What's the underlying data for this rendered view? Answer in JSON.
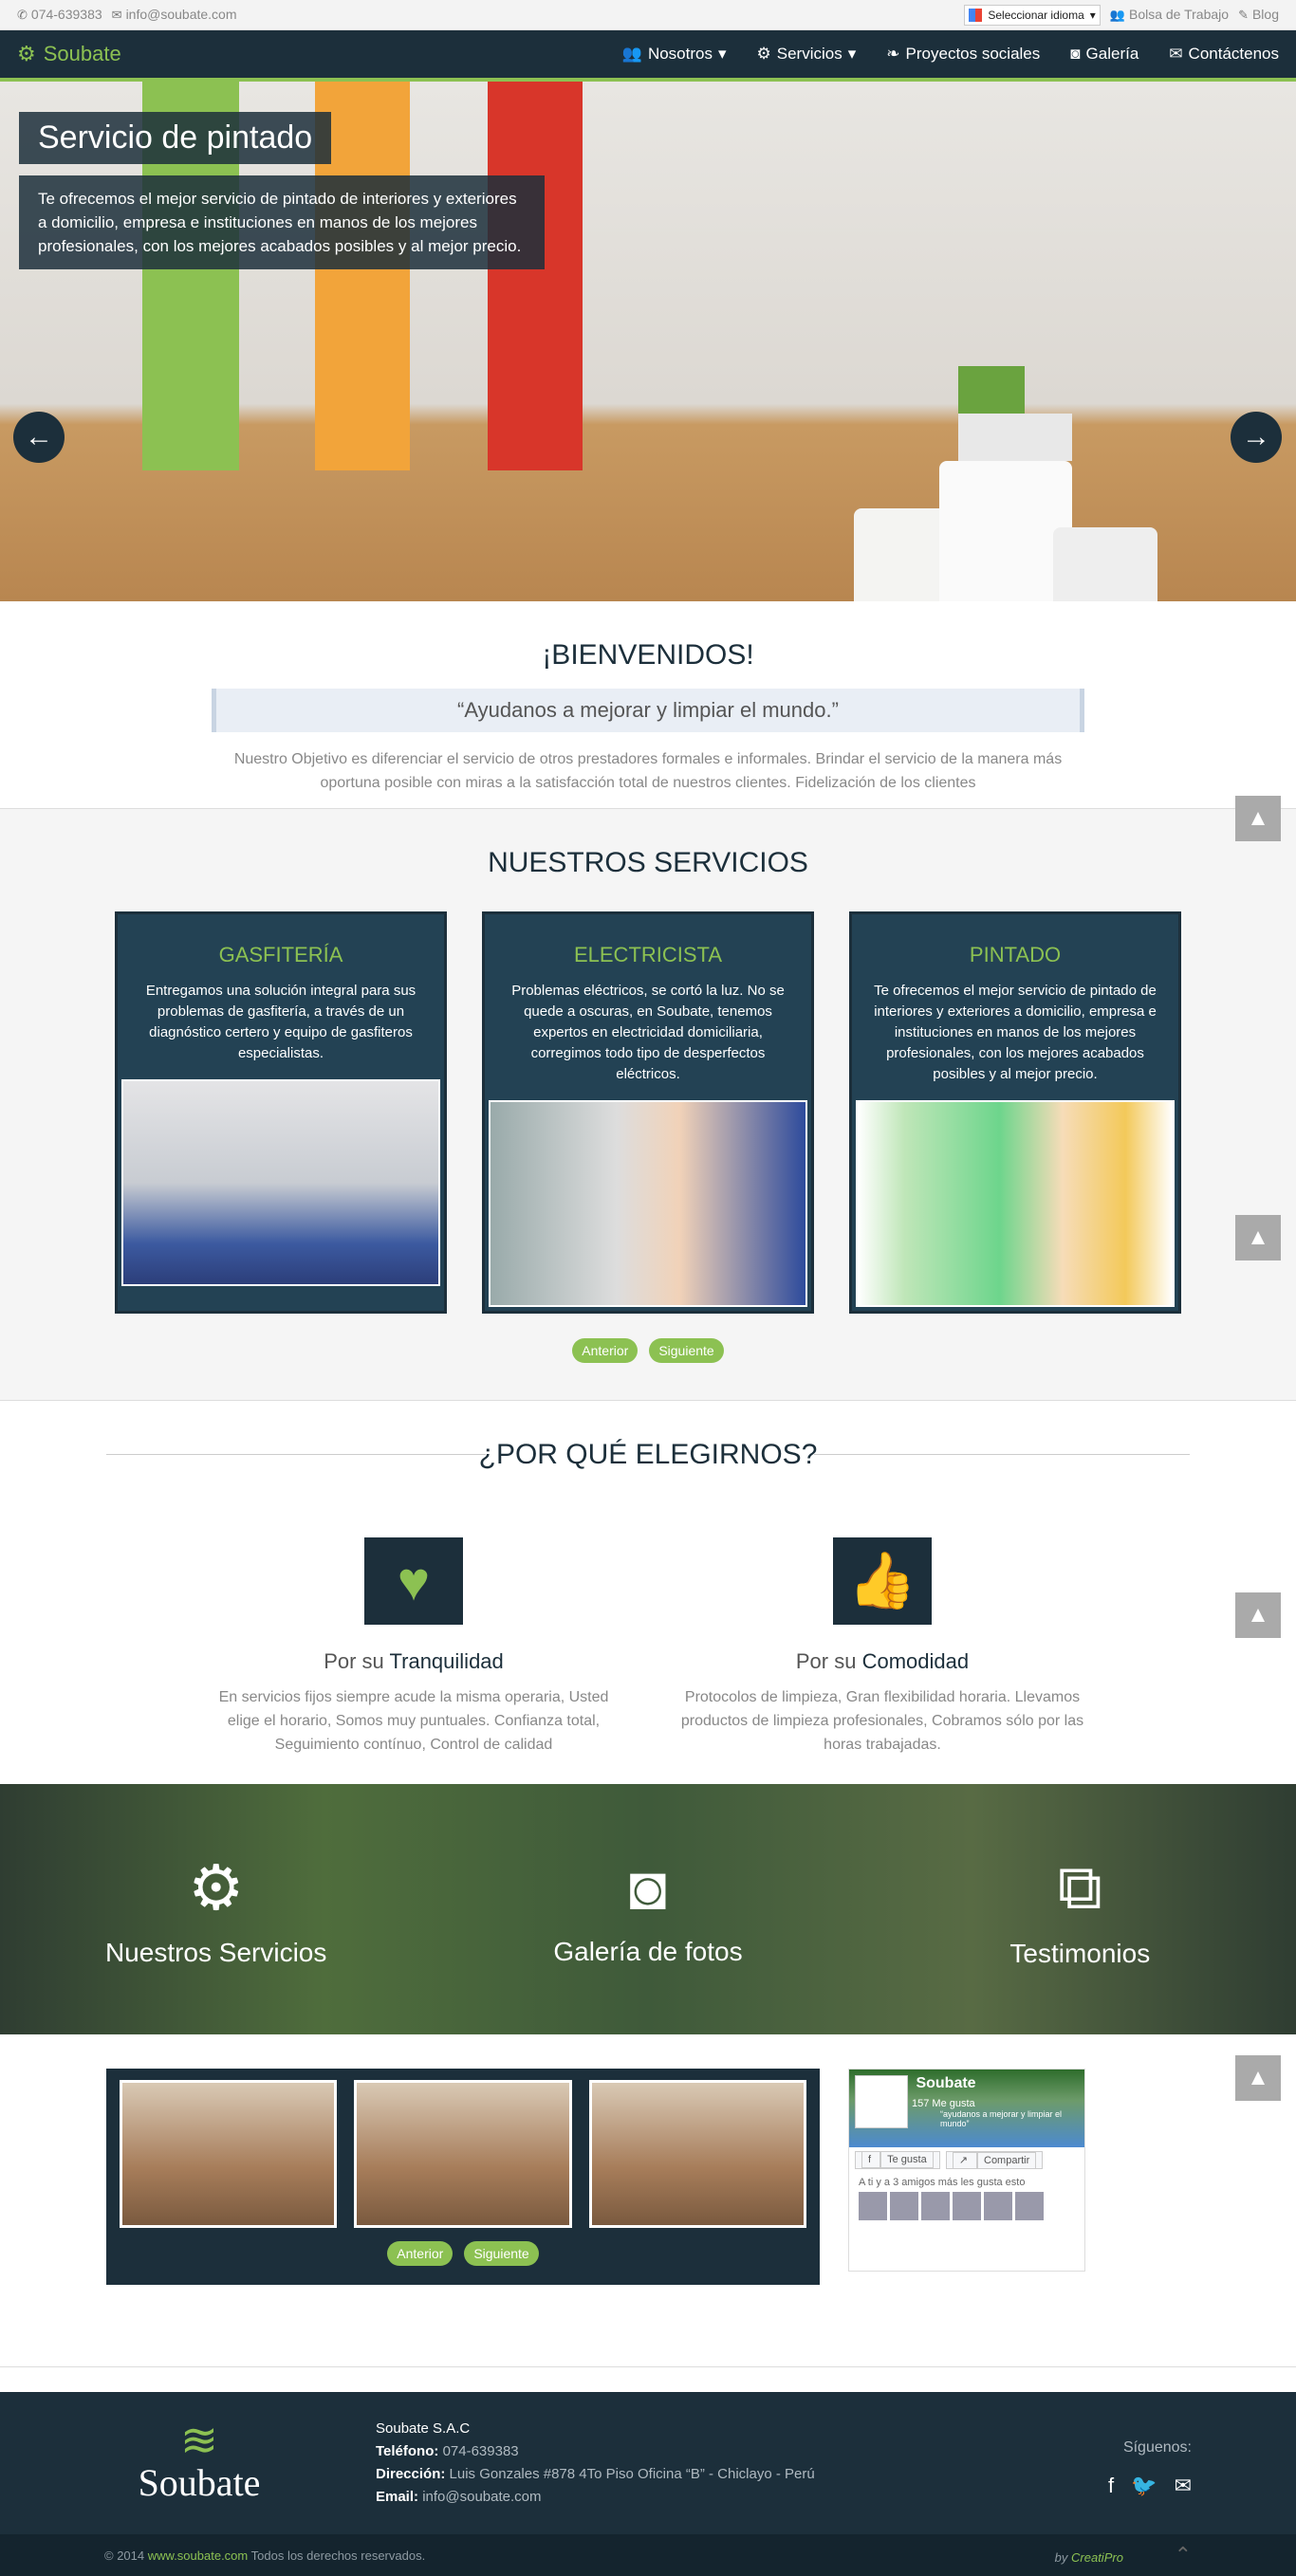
{
  "topbar": {
    "phone": "074-639383",
    "email": "info@soubate.com",
    "lang": "Seleccionar idioma",
    "jobs": "Bolsa de Trabajo",
    "blog": "Blog"
  },
  "nav": {
    "brand": "Soubate",
    "items": [
      "Nosotros",
      "Servicios",
      "Proyectos sociales",
      "Galería",
      "Contáctenos"
    ]
  },
  "hero": {
    "title": "Servicio de pintado",
    "text": "Te ofrecemos el mejor servicio de pintado de interiores y exteriores a domicilio, empresa e instituciones en manos de los mejores profesionales, con los mejores acabados posibles y al mejor precio."
  },
  "welcome": {
    "title": "¡BIENVENIDOS!",
    "quote": "“Ayudanos a mejorar y limpiar el mundo.”",
    "text": "Nuestro Objetivo es diferenciar el servicio de otros prestadores formales e informales. Brindar el servicio de la manera más oportuna posible con miras a la satisfacción total de nuestros clientes. Fidelización de los clientes"
  },
  "services": {
    "title": "NUESTROS SERVICIOS",
    "prev": "Anterior",
    "next": "Siguiente",
    "cards": [
      {
        "title": "GASFITERÍA",
        "text": "Entregamos una solución integral para sus problemas de gasfitería, a través de un diagnóstico certero y equipo de gasfiteros especialistas."
      },
      {
        "title": "ELECTRICISTA",
        "text": "Problemas eléctricos, se cortó la luz. No se quede a oscuras, en Soubate, tenemos expertos en electricidad domiciliaria, corregimos todo tipo de desperfectos eléctricos."
      },
      {
        "title": "PINTADO",
        "text": "Te ofrecemos el mejor servicio de pintado de interiores y exteriores a domicilio, empresa e instituciones en manos de los mejores profesionales, con los mejores acabados posibles y al mejor precio."
      }
    ]
  },
  "why": {
    "title": "¿POR QUÉ ELEGIRNOS?",
    "pre": "Por su",
    "items": [
      {
        "name": "Tranquilidad",
        "text": "En servicios fijos siempre acude la misma operaria, Usted elige el horario, Somos muy puntuales. Confianza total, Seguimiento contínuo, Control de calidad"
      },
      {
        "name": "Comodidad",
        "text": "Protocolos de limpieza, Gran flexibilidad horaria. Llevamos productos de limpieza profesionales, Cobramos sólo por las horas trabajadas."
      }
    ]
  },
  "band": [
    "Nuestros Servicios",
    "Galería de fotos",
    "Testimonios"
  ],
  "gallery": {
    "prev": "Anterior",
    "next": "Siguiente"
  },
  "fb": {
    "name": "Soubate",
    "likes": "157 Me gusta",
    "slogan": "“ayudanos a mejorar y limpiar el mundo”",
    "like": "Te gusta",
    "share": "Compartir",
    "friends": "A ti y a 3 amigos más les gusta esto"
  },
  "footer": {
    "company": "Soubate S.A.C",
    "phone_l": "Teléfono:",
    "phone": "074-639383",
    "addr_l": "Dirección:",
    "addr": "Luis Gonzales #878 4To Piso Oficina “B” - Chiclayo - Perú",
    "email_l": "Email:",
    "email": "info@soubate.com",
    "follow": "Síguenos:",
    "logo": "Soubate",
    "copy_pre": "© 2014",
    "copy_link": "www.soubate.com",
    "copy_post": "Todos los derechos reservados.",
    "by": "by",
    "by_name": "CreatiPro"
  },
  "colors": {
    "navy": "#1c2f3b",
    "green": "#8cc152"
  }
}
